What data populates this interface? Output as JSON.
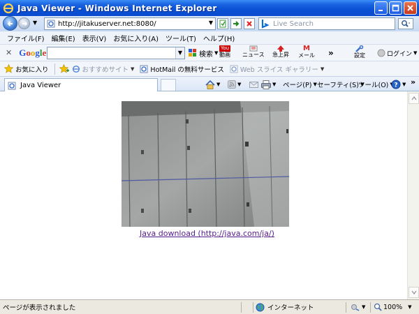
{
  "window": {
    "title": "Java Viewer - Windows Internet Explorer"
  },
  "address": {
    "url": "http://jitakuserver.net:8080/",
    "search_placeholder": "Live Search"
  },
  "menu": [
    "ファイル(F)",
    "編集(E)",
    "表示(V)",
    "お気に入り(A)",
    "ツール(T)",
    "ヘルプ(H)"
  ],
  "google_toolbar": {
    "logo": "Google",
    "search_label": "検索",
    "tools": [
      {
        "name": "youtube",
        "label": "動画"
      },
      {
        "name": "news",
        "label": "ニュース"
      },
      {
        "name": "rising",
        "label": "急上昇"
      },
      {
        "name": "mail",
        "label": "メール"
      },
      {
        "name": "settings",
        "label": "設定"
      },
      {
        "name": "login",
        "label": "ログイン"
      }
    ],
    "more": "»"
  },
  "favorites_bar": {
    "favorites_label": "お気に入り",
    "suggested_sites": "おすすめサイト",
    "hotmail": "HotMail の無料サービス",
    "web_slice": "Web スライス ギャラリー"
  },
  "tabs": {
    "active_tab": "Java Viewer"
  },
  "command_bar": {
    "page": "ページ(P)",
    "safety": "セーフティ(S)",
    "tools": "ツール(O)",
    "more": "»"
  },
  "content": {
    "java_link": "Java download (http://java.com/ja/)"
  },
  "status": {
    "text": "ページが表示されました",
    "zone": "インターネット",
    "zoom": "100%"
  },
  "colors": {
    "titlebar": "#0a50d4",
    "link_visited": "#551a8b",
    "toolbar_bg": "#f2f5fa"
  }
}
